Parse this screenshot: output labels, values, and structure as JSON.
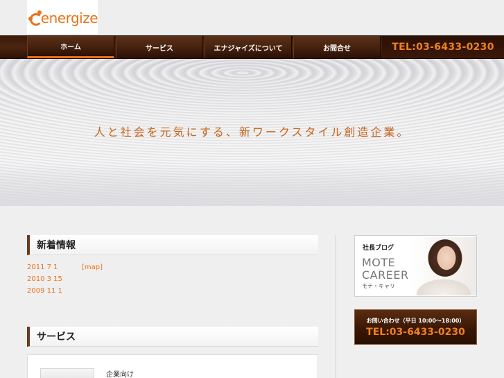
{
  "logo": {
    "text": "energize",
    "icon": "energize-logo-icon",
    "color": "#e8731a"
  },
  "nav": {
    "items": [
      {
        "label": "ホーム",
        "active": true
      },
      {
        "label": "サービス",
        "active": false
      },
      {
        "label": "エナジャイズについて",
        "active": false
      },
      {
        "label": "お問合せ",
        "active": false
      }
    ],
    "tel": "TEL:03-6433-0230"
  },
  "hero": {
    "tagline": "人と社会を元気にする、新ワークスタイル創造企業。"
  },
  "news": {
    "title": "新着情報",
    "items": [
      {
        "date": "2011 7 1",
        "link": "[map]"
      },
      {
        "date": "2010 3 15",
        "link": ""
      },
      {
        "date": "2009 11 1",
        "link": ""
      }
    ]
  },
  "service": {
    "title": "サービス",
    "items": [
      {
        "label": "企業向け"
      }
    ]
  },
  "sidebar": {
    "blog": {
      "label_jp": "社長ブログ",
      "title_line1": "MOTE",
      "title_line2": "CAREER",
      "kana": "モテ・キャリ"
    },
    "contact": {
      "label": "お問い合わせ（平日 10:00〜18:00）",
      "tel": "TEL:03-6433-0230"
    }
  },
  "colors": {
    "accent": "#e8731a",
    "nav_bg": "#3a1a08"
  }
}
